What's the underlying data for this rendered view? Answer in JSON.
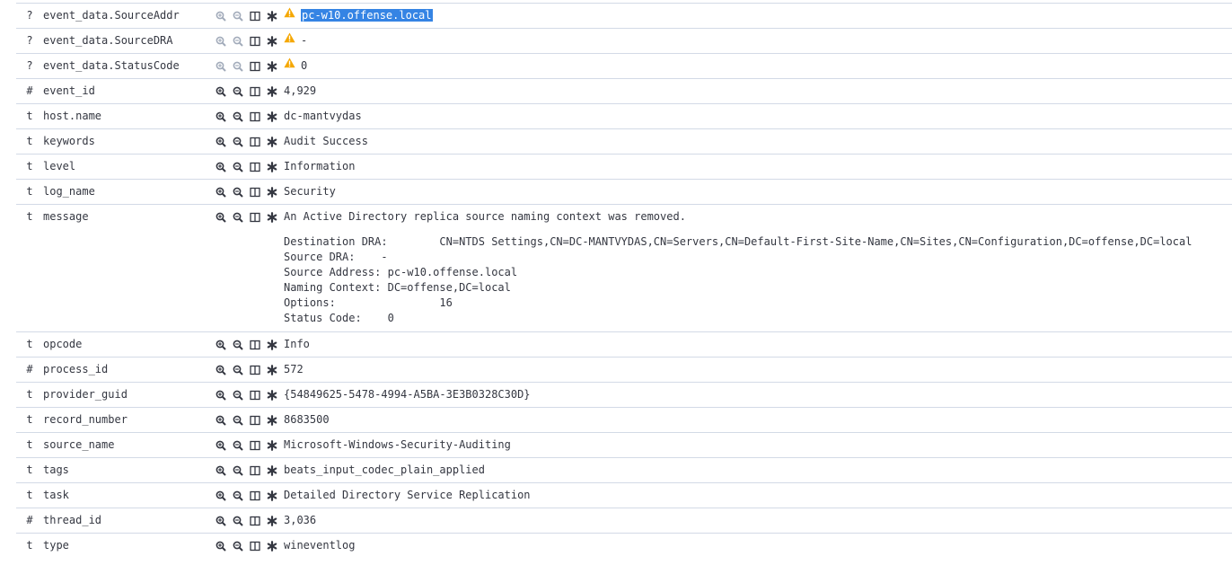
{
  "rows": [
    {
      "type": "?",
      "field": "event_data.SourceAddr",
      "value": "pc-w10.offense.local",
      "warning": true,
      "selected": true,
      "dim": true
    },
    {
      "type": "?",
      "field": "event_data.SourceDRA",
      "value": "-",
      "warning": true,
      "dim": true
    },
    {
      "type": "?",
      "field": "event_data.StatusCode",
      "value": "0",
      "warning": true,
      "dim": true
    },
    {
      "type": "#",
      "field": "event_id",
      "value": "4,929"
    },
    {
      "type": "t",
      "field": "host.name",
      "value": "dc-mantvydas"
    },
    {
      "type": "t",
      "field": "keywords",
      "value": "Audit Success"
    },
    {
      "type": "t",
      "field": "level",
      "value": "Information"
    },
    {
      "type": "t",
      "field": "log_name",
      "value": "Security"
    },
    {
      "type": "t",
      "field": "message",
      "value": "An Active Directory replica source naming context was removed.",
      "message_lines": [
        "Destination DRA:        CN=NTDS Settings,CN=DC-MANTVYDAS,CN=Servers,CN=Default-First-Site-Name,CN=Sites,CN=Configuration,DC=offense,DC=local",
        "Source DRA:    -",
        "Source Address: pc-w10.offense.local",
        "Naming Context: DC=offense,DC=local",
        "Options:                16",
        "Status Code:    0"
      ]
    },
    {
      "type": "t",
      "field": "opcode",
      "value": "Info"
    },
    {
      "type": "#",
      "field": "process_id",
      "value": "572"
    },
    {
      "type": "t",
      "field": "provider_guid",
      "value": "{54849625-5478-4994-A5BA-3E3B0328C30D}"
    },
    {
      "type": "t",
      "field": "record_number",
      "value": "8683500"
    },
    {
      "type": "t",
      "field": "source_name",
      "value": "Microsoft-Windows-Security-Auditing"
    },
    {
      "type": "t",
      "field": "tags",
      "value": "beats_input_codec_plain_applied"
    },
    {
      "type": "t",
      "field": "task",
      "value": "Detailed Directory Service Replication"
    },
    {
      "type": "#",
      "field": "thread_id",
      "value": "3,036"
    },
    {
      "type": "t",
      "field": "type",
      "value": "wineventlog"
    }
  ],
  "icons": {
    "filter_for": "zoom-in-icon",
    "filter_out": "zoom-out-icon",
    "toggle_column": "column-icon",
    "filter_exists": "asterisk-icon",
    "warning": "warning-icon"
  },
  "colors": {
    "border": "#d3dae6",
    "text": "#343741",
    "warning": "#f5a700",
    "selection": "#3584e4",
    "icon_dim": "#a2abba",
    "icon": "#343741"
  }
}
